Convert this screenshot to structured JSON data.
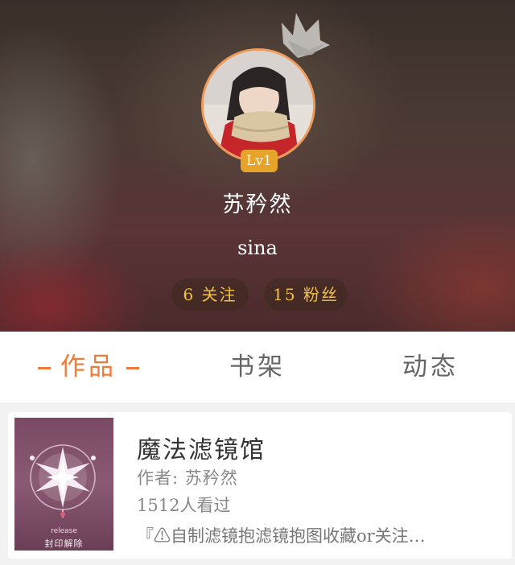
{
  "profile": {
    "level": "Lv1",
    "username": "苏矜然",
    "source": "sina",
    "following": "6 关注",
    "fans": "15 粉丝"
  },
  "tabs": {
    "works": "作品",
    "bookshelf": "书架",
    "activity": "动态"
  },
  "book": {
    "title": "魔法滤镜馆",
    "author": "作者: 苏矜然",
    "views": "1512人看过",
    "description": "『⚠自制滤镜抱滤镜抱图收藏or关注…",
    "cover_subtitle": "release",
    "cover_title": "封印解除"
  },
  "colors": {
    "accent": "#f07a3a",
    "level_badge": "#e7a42a",
    "stat_text": "#f3c04a"
  }
}
